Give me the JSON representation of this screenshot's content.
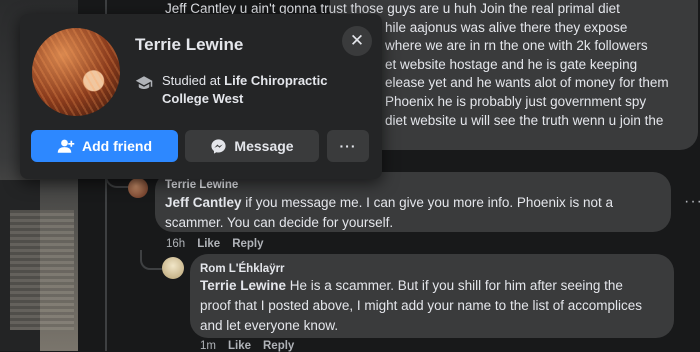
{
  "top_comment": {
    "lines": [
      "Jeff Cantley u ain't gonna trust those guys are u huh Join the real primal diet",
      "                                          hile aajonus was alive there they expose",
      "                                          where we are in rn the one with 2k followers",
      "                                          et website hostage and he is gate keeping",
      "                                          elease yet and he wants alot of money for them",
      "                                          Phoenix he is probably just government spy",
      "                                          diet website u will see the truth wenn u join the"
    ]
  },
  "profile_card": {
    "name": "Terrie Lewine",
    "studied_prefix": "Studied at ",
    "school": "Life Chiropractic College West",
    "add_friend_label": "Add friend",
    "message_label": "Message",
    "more_label": "···",
    "close_label": "✕",
    "icons": {
      "add_friend": "add-person-icon",
      "message": "messenger-icon",
      "education": "graduation-cap-icon"
    },
    "accent_color": "#2d88ff"
  },
  "comments": [
    {
      "author": "Terrie Lewine",
      "mention": "Jeff Cantley",
      "text": " if you message me. I can give you more info. Phoenix is not a scammer. You can decide for yourself.",
      "time": "16h",
      "like": "Like",
      "reply": "Reply",
      "more": "···"
    },
    {
      "author": "Rom L'Éhklaÿrr",
      "mention": "Terrie Lewine",
      "text": " He is a scammer. But if you shill for him after seeing the proof that I posted above, I might add your name to the list of accomplices and let everyone know.",
      "time": "1m",
      "like": "Like",
      "reply": "Reply"
    }
  ]
}
